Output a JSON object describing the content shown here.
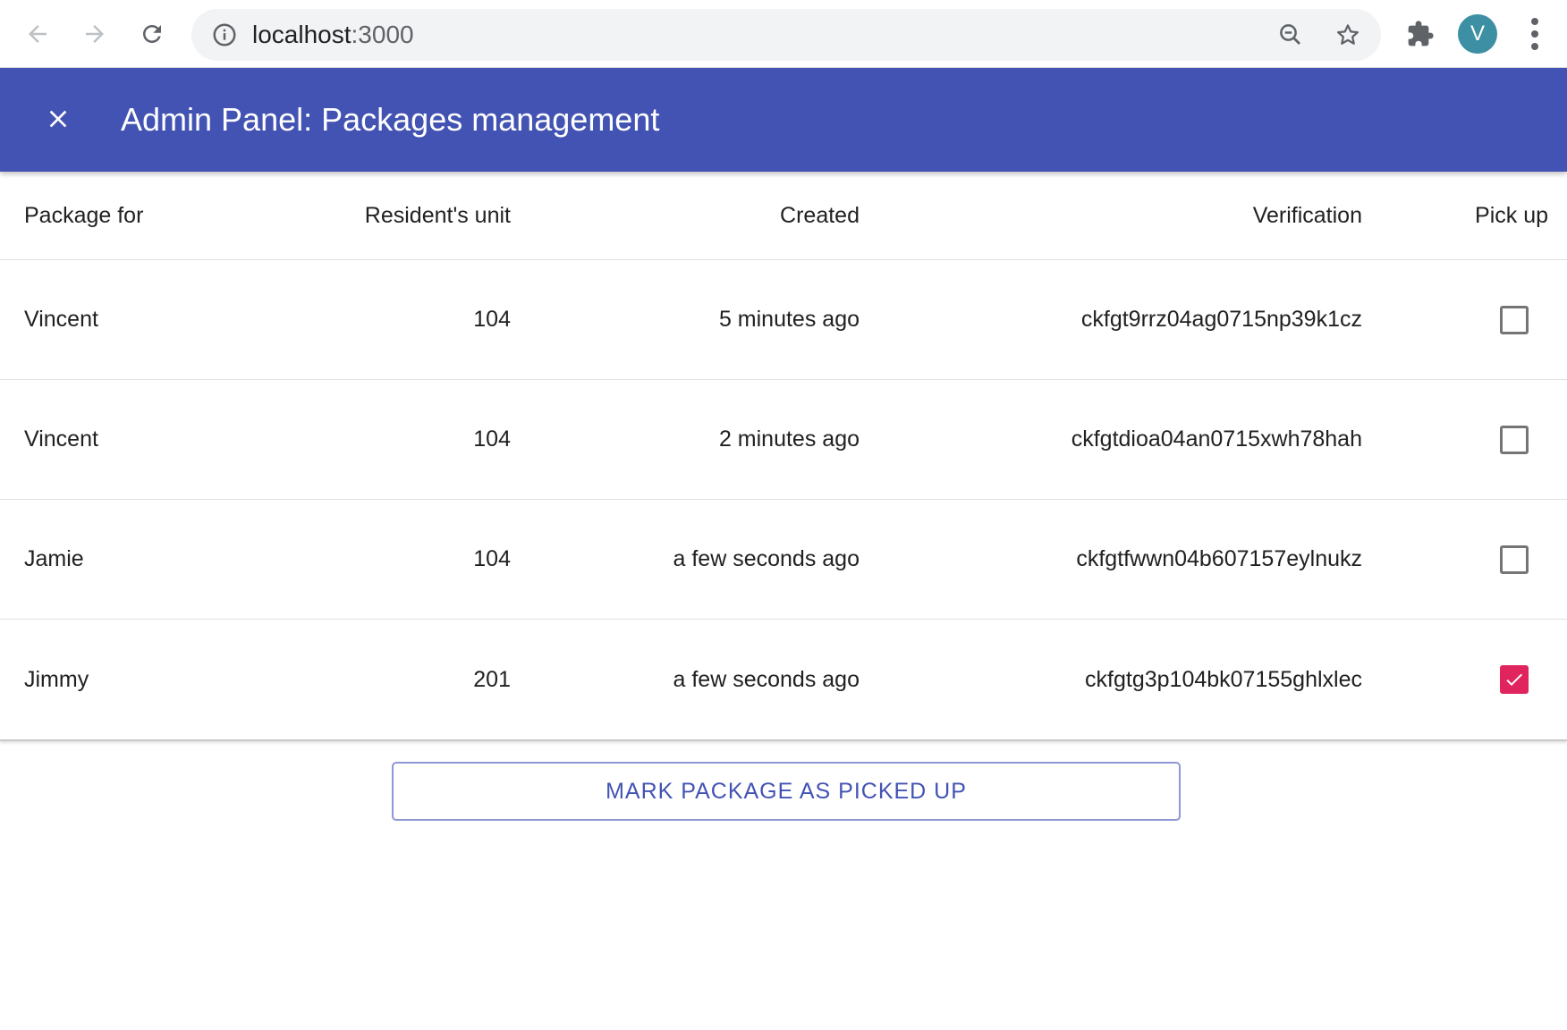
{
  "browser": {
    "url_host": "localhost",
    "url_port": ":3000",
    "profile_initial": "V"
  },
  "app_bar": {
    "title": "Admin Panel: Packages management",
    "color": "#4353b3"
  },
  "table": {
    "columns": [
      "Package for",
      "Resident's unit",
      "Created",
      "Verification",
      "Pick up"
    ],
    "rows": [
      {
        "name": "Vincent",
        "unit": "104",
        "created": "5 minutes ago",
        "verification": "ckfgt9rrz04ag0715np39k1cz",
        "picked": false
      },
      {
        "name": "Vincent",
        "unit": "104",
        "created": "2 minutes ago",
        "verification": "ckfgtdioa04an0715xwh78hah",
        "picked": false
      },
      {
        "name": "Jamie",
        "unit": "104",
        "created": "a few seconds ago",
        "verification": "ckfgtfwwn04b607157eylnukz",
        "picked": false
      },
      {
        "name": "Jimmy",
        "unit": "201",
        "created": "a few seconds ago",
        "verification": "ckfgtg3p104bk07155ghlxlec",
        "picked": true
      }
    ]
  },
  "action_button": {
    "label": "MARK PACKAGE AS PICKED UP"
  },
  "colors": {
    "checkbox_checked": "#e0245e",
    "avatar": "#3d8fa3"
  },
  "icons": {
    "back": "arrow-left-icon",
    "forward": "arrow-right-icon",
    "reload": "reload-icon",
    "info": "info-icon",
    "zoom": "zoom-out-icon",
    "bookmark": "star-icon",
    "extensions": "puzzle-icon",
    "menu": "more-vert-icon",
    "close": "close-icon",
    "check": "check-icon"
  }
}
